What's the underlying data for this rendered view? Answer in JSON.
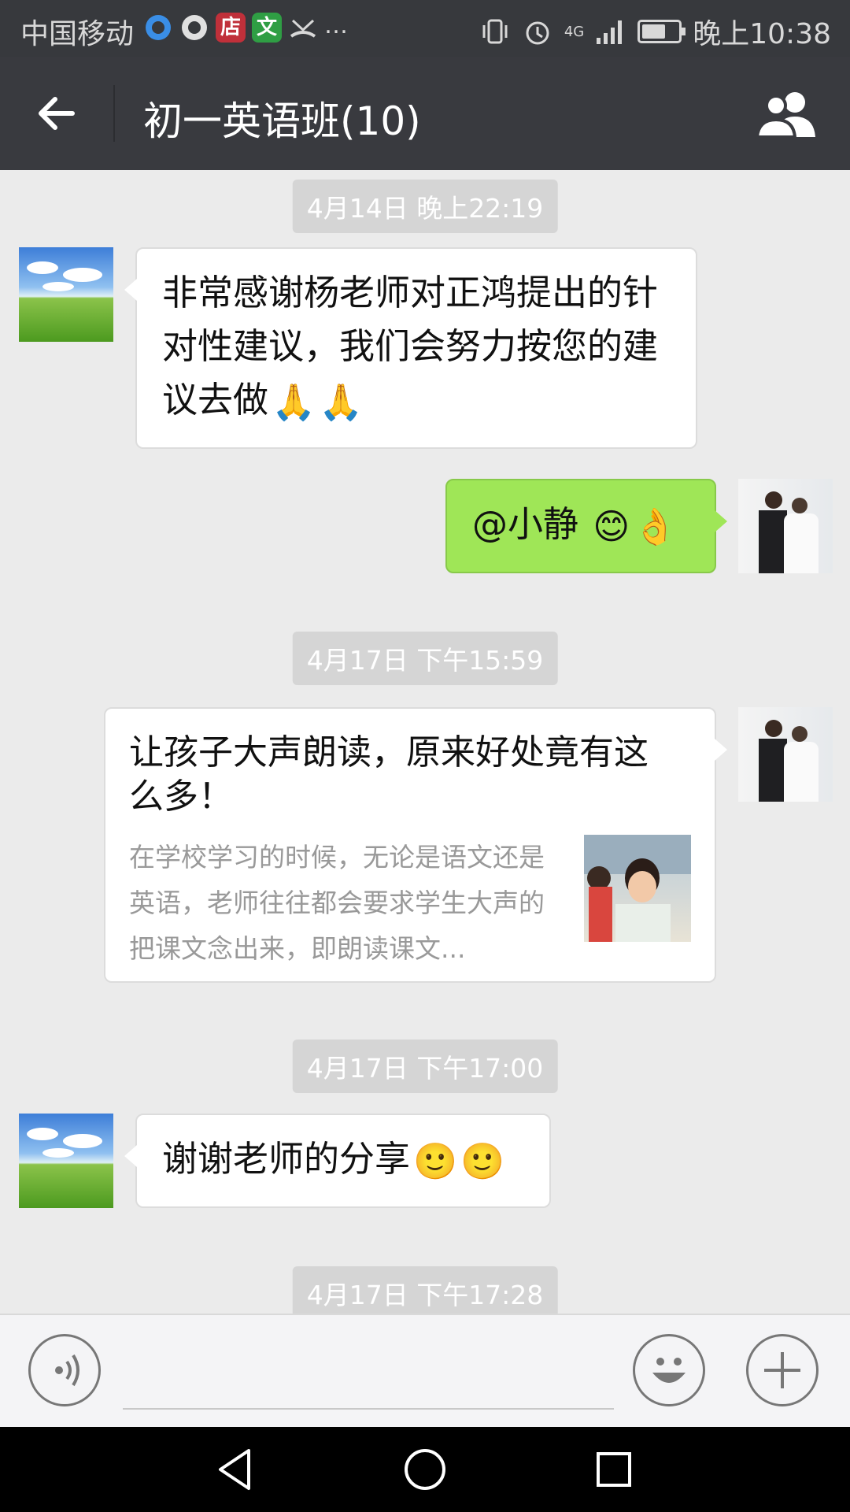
{
  "status_bar": {
    "carrier": "中国移动",
    "notif_icons": [
      "browser-icon",
      "q-icon",
      "店",
      "文",
      "missed-call-icon",
      "…"
    ],
    "network": "4G",
    "battery_percent": 65,
    "time": "晚上10:38"
  },
  "header": {
    "title": "初一英语班(10)"
  },
  "messages": [
    {
      "type": "timestamp",
      "text": "4月14日 晚上22:19"
    },
    {
      "type": "text",
      "side": "left",
      "text": "非常感谢杨老师对正鸿提出的针对性建议，我们会努力按您的建议去做",
      "emojis": [
        "🙏",
        "🙏"
      ]
    },
    {
      "type": "text",
      "side": "right",
      "text": "@小静 ",
      "emojis": [
        "😊",
        "👌"
      ]
    },
    {
      "type": "timestamp",
      "text": "4月17日 下午15:59"
    },
    {
      "type": "link",
      "side": "right",
      "title": "让孩子大声朗读，原来好处竟有这么多！",
      "description": "在学校学习的时候，无论是语文还是英语，老师往往都会要求学生大声的把课文念出来，即朗读课文..."
    },
    {
      "type": "timestamp",
      "text": "4月17日 下午17:00"
    },
    {
      "type": "text",
      "side": "left",
      "text": "谢谢老师的分享",
      "emojis": [
        "🙂",
        "🙂"
      ]
    },
    {
      "type": "timestamp",
      "text": "4月17日 下午17:28"
    }
  ],
  "input_bar": {
    "voice_icon": "voice-icon",
    "emoji_icon": "emoji-icon",
    "plus_icon": "plus-icon"
  },
  "colors": {
    "title_bar": "#393a3f",
    "chat_bg": "#ebebeb",
    "sent_bubble": "#9fe657",
    "received_bubble": "#ffffff"
  }
}
